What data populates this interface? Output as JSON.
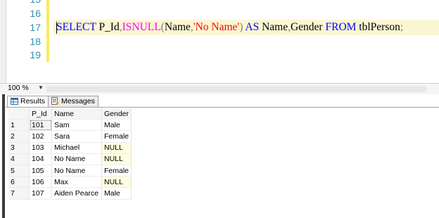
{
  "editor": {
    "line_numbers": [
      "15",
      "16",
      "17",
      "18",
      "19"
    ],
    "code_tokens": {
      "t1": "SELECT",
      "t2": " P_Id",
      "t3": ",",
      "t4": "ISNULL",
      "t5": "(",
      "t6": "Name",
      "t7": ",",
      "t8": "'No Name'",
      "t9": ")",
      "t10": " AS ",
      "t11": "Name",
      "t12": ",",
      "t13": "Gender ",
      "t14": "FROM",
      "t15": " tblPerson",
      "t16": ";"
    }
  },
  "zoom": {
    "value": "100 %"
  },
  "tabs": [
    {
      "label": "Results",
      "icon": "grid-icon"
    },
    {
      "label": "Messages",
      "icon": "messages-icon"
    }
  ],
  "grid": {
    "columns": [
      "P_Id",
      "Name",
      "Gender"
    ],
    "rows": [
      {
        "n": "1",
        "id": "101",
        "name": "Sam",
        "gender": "Male"
      },
      {
        "n": "2",
        "id": "102",
        "name": "Sara",
        "gender": "Female"
      },
      {
        "n": "3",
        "id": "103",
        "name": "Michael",
        "gender": "NULL"
      },
      {
        "n": "4",
        "id": "104",
        "name": "No Name",
        "gender": "NULL"
      },
      {
        "n": "5",
        "id": "105",
        "name": "No Name",
        "gender": "Female"
      },
      {
        "n": "6",
        "id": "106",
        "name": "Max",
        "gender": "NULL"
      },
      {
        "n": "7",
        "id": "107",
        "name": "Aiden Pearce",
        "gender": "Male"
      }
    ]
  },
  "colors": {
    "keyword": "#0000ff",
    "function": "#ff00ff",
    "string": "#ff0000",
    "operator": "#808080",
    "line_number": "#2b91af",
    "change_bar": "#fde962"
  }
}
